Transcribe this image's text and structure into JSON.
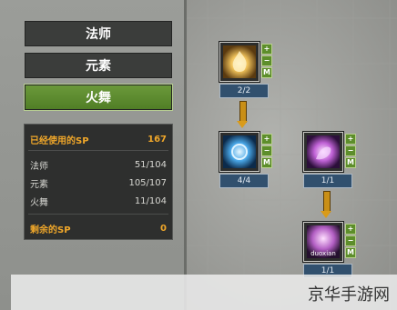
{
  "classes": {
    "mage": "法师",
    "element": "元素",
    "fire_dance": "火舞"
  },
  "sp": {
    "used_label": "已经使用的SP",
    "used_value": "167",
    "rows": [
      {
        "label": "法师",
        "value": "51/104"
      },
      {
        "label": "元素",
        "value": "105/107"
      },
      {
        "label": "火舞",
        "value": "11/104"
      }
    ],
    "remaining_label": "剩余的SP",
    "remaining_value": "0"
  },
  "skills": [
    {
      "level": "2/2",
      "icon": "flame-spirit-icon"
    },
    {
      "level": "4/4",
      "icon": "blue-swirl-icon"
    },
    {
      "level": "1/1",
      "icon": "purple-spirit-icon"
    },
    {
      "level": "1/1",
      "icon": "duoxian-icon",
      "caption": "duoxian"
    }
  ],
  "controls": {
    "plus": "+",
    "minus": "−",
    "max": "M"
  },
  "watermark": "京华手游网",
  "colors": {
    "active_green": "#5b8a2d",
    "sp_orange": "#f0a72a",
    "level_blue": "#31506e"
  }
}
